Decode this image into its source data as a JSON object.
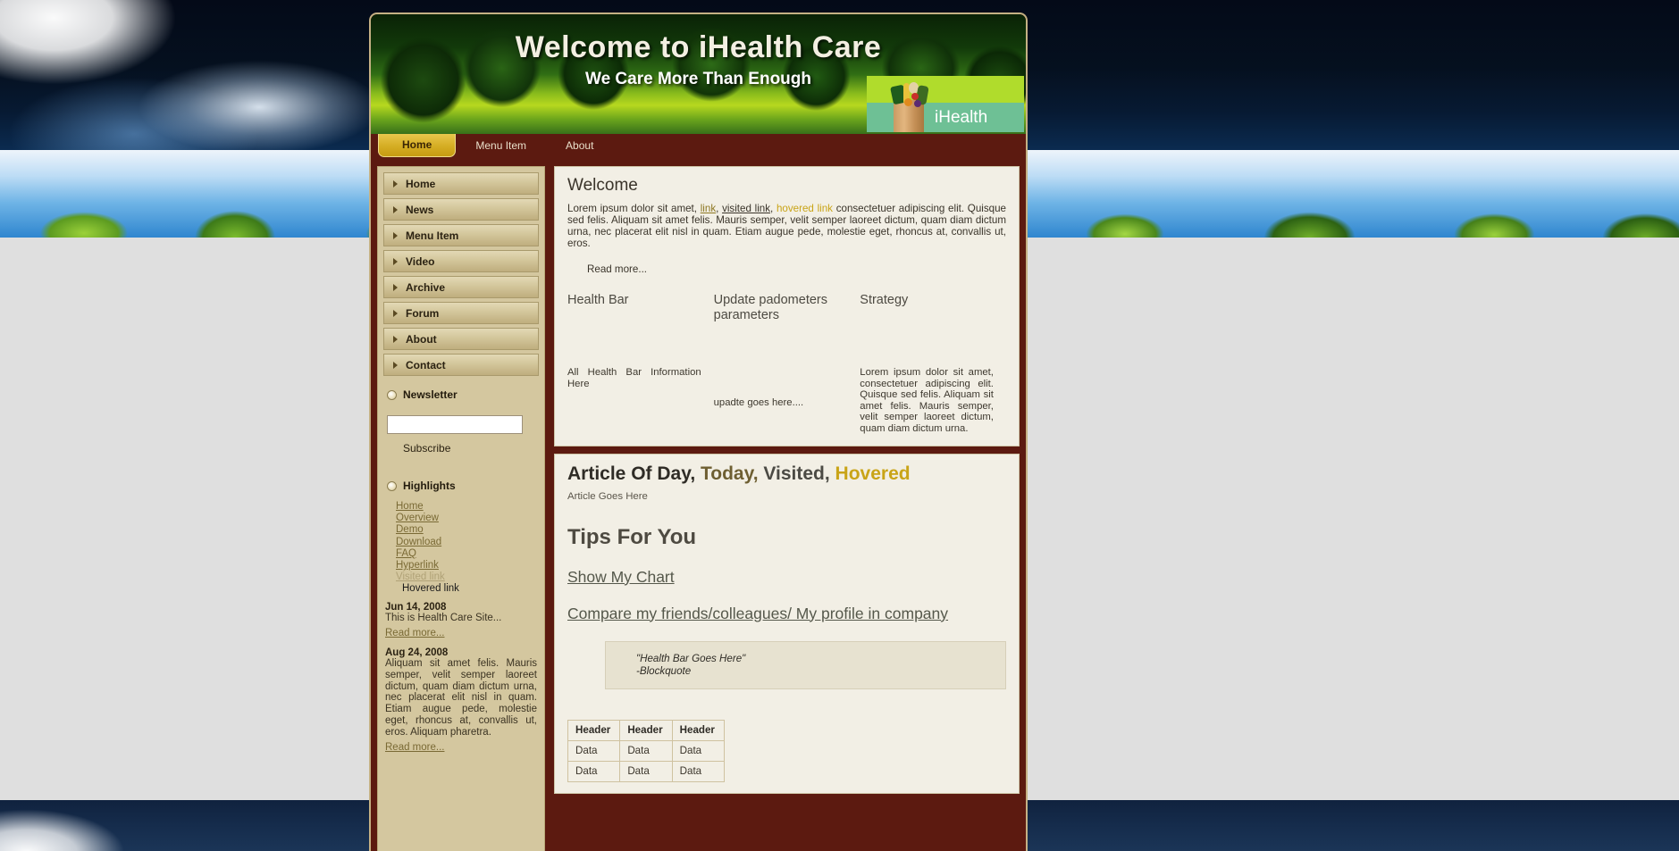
{
  "site": {
    "banner_title": "Welcome to iHealth Care",
    "banner_subtitle": "We Care More Than Enough",
    "logo_text": "iHealth"
  },
  "topnav": {
    "items": [
      {
        "label": "Home",
        "active": true
      },
      {
        "label": "Menu Item",
        "active": false
      },
      {
        "label": "About",
        "active": false
      }
    ]
  },
  "sidebar": {
    "menu": [
      {
        "label": "Home"
      },
      {
        "label": "News"
      },
      {
        "label": "Menu Item"
      },
      {
        "label": "Video"
      },
      {
        "label": "Archive"
      },
      {
        "label": "Forum"
      },
      {
        "label": "About"
      },
      {
        "label": "Contact"
      }
    ],
    "newsletter": {
      "heading": "Newsletter",
      "value": "",
      "placeholder": "",
      "subscribe_label": "Subscribe"
    },
    "highlights": {
      "heading": "Highlights",
      "links": [
        {
          "label": "Home",
          "state": "normal"
        },
        {
          "label": "Overview",
          "state": "normal"
        },
        {
          "label": "Demo",
          "state": "normal"
        },
        {
          "label": "Download",
          "state": "normal"
        },
        {
          "label": "FAQ",
          "state": "normal"
        },
        {
          "label": "Hyperlink",
          "state": "normal"
        },
        {
          "label": "Visited link",
          "state": "visited"
        },
        {
          "label": "Hovered link",
          "state": "hovered"
        }
      ]
    },
    "news": [
      {
        "date": "Jun 14, 2008",
        "text": "This is Health Care Site...",
        "read_more": "Read more..."
      },
      {
        "date": "Aug 24, 2008",
        "text": "Aliquam sit amet felis. Mauris semper, velit semper laoreet dictum, quam diam dictum urna, nec placerat elit nisl in quam. Etiam augue pede, molestie eget, rhoncus at, convallis ut, eros. Aliquam pharetra.",
        "read_more": "Read more..."
      }
    ]
  },
  "welcome": {
    "heading": "Welcome",
    "text_1": "Lorem ipsum dolor sit amet, ",
    "link": "link",
    "sep_1": ", ",
    "visited_link": "visited link",
    "sep_2": ", ",
    "hovered_link": "hovered link",
    "text_2": " consectetuer adipiscing elit. Quisque sed felis. Aliquam sit amet felis. Mauris semper, velit semper laoreet dictum, quam diam dictum urna, nec placerat elit nisl in quam. Etiam augue pede, molestie eget, rhoncus at, convallis ut, eros.",
    "read_more": "Read more...",
    "columns": [
      {
        "heading": "Health Bar",
        "body": "All Health Bar Information Here"
      },
      {
        "heading": "Update padometers parameters",
        "body": "upadte goes here...."
      },
      {
        "heading": "Strategy",
        "body": "Lorem ipsum dolor sit amet, consectetuer adipiscing elit. Quisque sed felis. Aliquam sit amet felis. Mauris semper, velit semper laoreet dictum, quam diam dictum urna."
      }
    ]
  },
  "article": {
    "title_main": "Article Of Day,",
    "title_today": " Today,",
    "title_visited": " Visited,",
    "title_hovered": " Hovered",
    "subtitle": "Article Goes Here",
    "tips_heading": "Tips For You",
    "tip_links": [
      "Show My Chart",
      "Compare my friends/colleagues/ My profile in company"
    ],
    "blockquote_line1": "\"Health Bar Goes Here\"",
    "blockquote_line2": "-Blockquote",
    "table": {
      "headers": [
        "Header",
        "Header",
        "Header"
      ],
      "rows": [
        [
          "Data",
          "Data",
          "Data"
        ],
        [
          "Data",
          "Data",
          "Data"
        ]
      ]
    }
  },
  "colors": {
    "frame": "#5c1a10",
    "accent_gold": "#d5ad23",
    "sidebar_bg": "#d4c79f",
    "panel_bg": "#f2efe5",
    "logo_green": "#b0dc2c",
    "logo_teal": "#6ec095"
  }
}
